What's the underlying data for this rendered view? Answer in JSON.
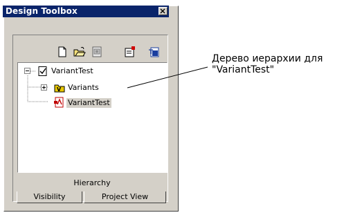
{
  "window": {
    "title": "Design Toolbox"
  },
  "toolbar": {
    "icons": [
      "new-document-icon",
      "open-folder-icon",
      "settings-icon",
      "properties-icon",
      "tc-icon"
    ]
  },
  "tree": {
    "items": [
      {
        "label": "VariantTest",
        "icon": "checked-document-icon",
        "expander": "minus"
      },
      {
        "label": "Variants",
        "icon": "variant-folder-icon",
        "expander": "plus"
      },
      {
        "label": "VariantTest",
        "icon": "red-document-icon",
        "selected": true
      }
    ]
  },
  "panel_label": "Hierarchy",
  "tabs": [
    {
      "label": "Visibility"
    },
    {
      "label": "Project View"
    }
  ],
  "annotation": {
    "line1": "Дерево иерархии для",
    "line2": "\"VariantTest\""
  },
  "colors": {
    "titlebar": "#0a246a",
    "panel": "#d4d0c8",
    "tree_bg": "#ffffff"
  }
}
